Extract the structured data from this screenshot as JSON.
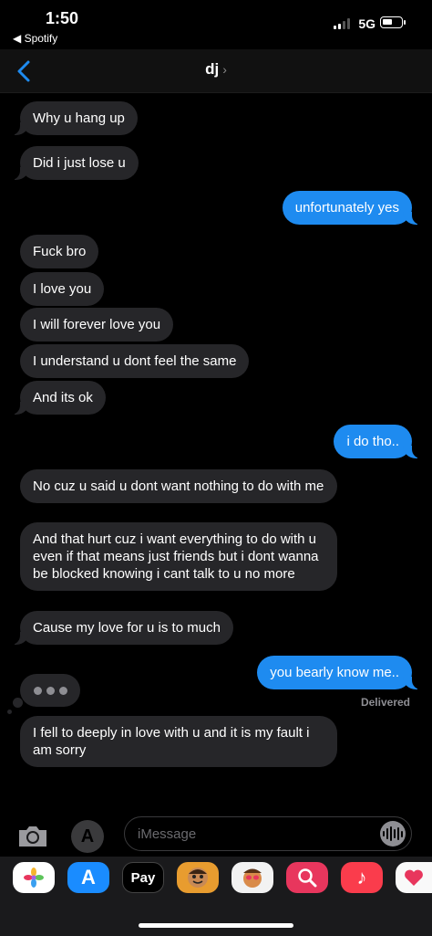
{
  "status_bar": {
    "time": "1:50",
    "back_app": "◀ Spotify",
    "network": "5G",
    "battery_level": 0.55
  },
  "header": {
    "contact_name": "dj",
    "chevron": "›"
  },
  "messages": [
    {
      "dir": "in",
      "text": "Why u hang up"
    },
    {
      "dir": "in",
      "text": "Did i just lose u"
    },
    {
      "dir": "out",
      "text": "unfortunately yes"
    },
    {
      "dir": "in",
      "text": "Fuck bro"
    },
    {
      "dir": "in",
      "text": "I love you"
    },
    {
      "dir": "in",
      "text": "I will forever love you"
    },
    {
      "dir": "in",
      "text": "I understand u dont feel the same"
    },
    {
      "dir": "in",
      "text": "And its ok"
    },
    {
      "dir": "out",
      "text": "i do tho.."
    },
    {
      "dir": "in",
      "text": "No cuz u said u dont want nothing to do with me"
    },
    {
      "dir": "in",
      "text": "And that hurt cuz i want everything to do with u even if that means just friends but i dont wanna be blocked knowing i cant talk to u no more"
    },
    {
      "dir": "in",
      "text": "Cause my love for u is to much"
    },
    {
      "dir": "out",
      "text": "you bearly know me.."
    },
    {
      "dir": "in",
      "text": "I fell to deeply in love with u and it is my fault i am sorry"
    }
  ],
  "delivered_label": "Delivered",
  "input": {
    "placeholder": "iMessage",
    "apps_icon_glyph": "A"
  },
  "drawer": {
    "apple_pay_label": "Pay",
    "apple_pay_glyph": "",
    "app_store_glyph": "A",
    "music_glyph": "♪",
    "colors": {
      "photos": "#ffffff",
      "appstore": "#1a8cff",
      "applepay": "#000000",
      "memoji": "#e89c2f",
      "stickers": "#f2f2f2",
      "search": "#e8365d",
      "music": "#fa3c4c",
      "heart": "#f9f9f9"
    }
  },
  "colors": {
    "incoming_bubble": "#262629",
    "outgoing_bubble": "#1e8bf0",
    "accent": "#1e8bf0"
  }
}
